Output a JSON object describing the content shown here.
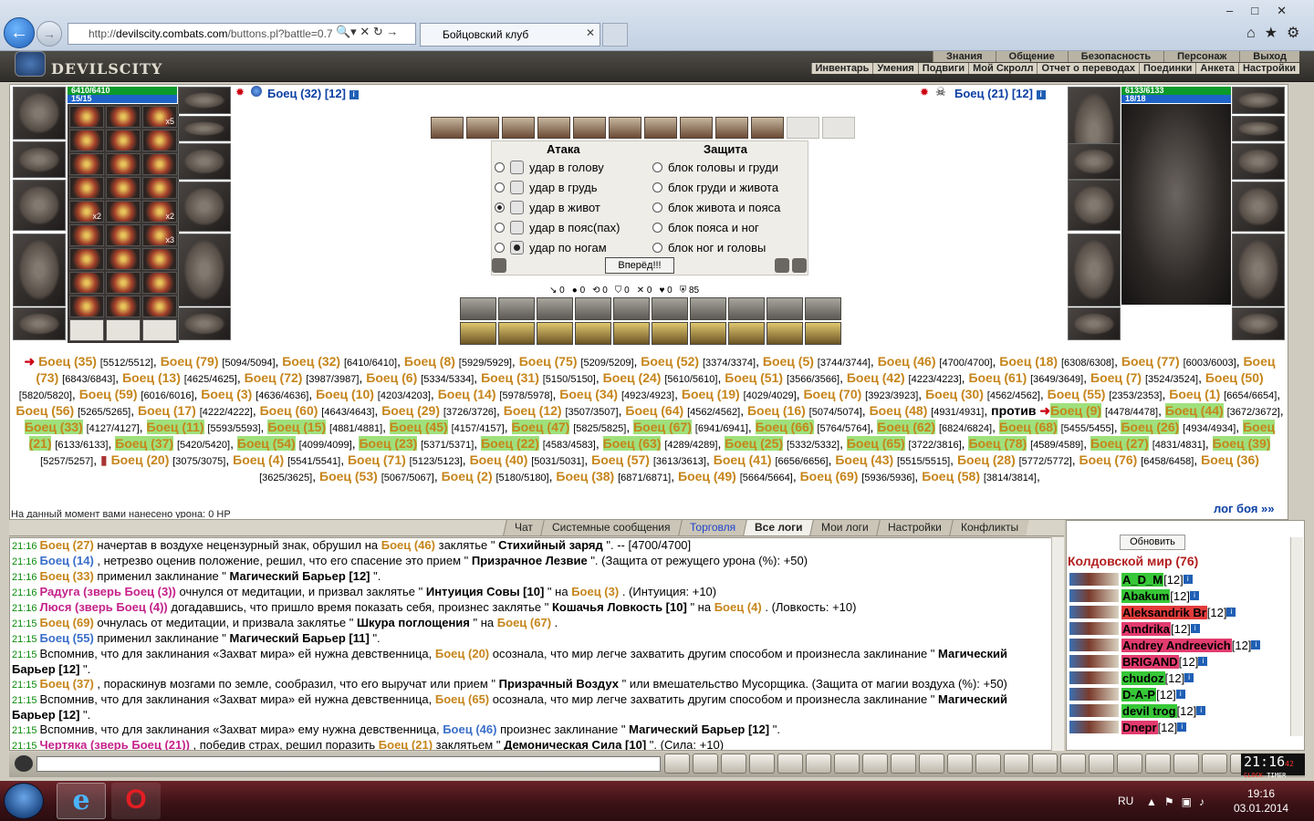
{
  "browser": {
    "url_host": "devilscity.combats.com",
    "url_prefix": "http://",
    "url_path": "/buttons.pl?battle=0.7",
    "tab_title": "Бойцовский клуб"
  },
  "header": {
    "logo": "DEVILSCITY",
    "menu_top": [
      "Знания",
      "Общение",
      "Безопасность",
      "Персонаж",
      "Выход"
    ],
    "menu_sub": [
      "Инвентарь",
      "Умения",
      "Подвиги",
      "Мой Скролл",
      "Отчет о переводах",
      "Поединки",
      "Анкета",
      "Настройки"
    ]
  },
  "player": {
    "name": "Боец (32) [12]",
    "hp": "6410/6410",
    "mana": "15/15",
    "inv_counts": [
      "x5",
      "x2",
      "x2",
      "x3"
    ]
  },
  "enemy": {
    "name": "Боец (21) [12]",
    "hp": "6133/6133",
    "mana": "18/18"
  },
  "attack": {
    "attack_header": "Атака",
    "defense_header": "Защита",
    "attack_options": [
      "удар в голову",
      "удар в грудь",
      "удар в живот",
      "удар в пояс(пах)",
      "удар по ногам"
    ],
    "defense_options": [
      "блок головы и груди",
      "блок груди и живота",
      "блок живота и пояса",
      "блок пояса и ног",
      "блок ног и головы"
    ],
    "go_button": "Вперёд!!!"
  },
  "stats": [
    "0",
    "0",
    "0",
    "0",
    "0",
    "0",
    "85"
  ],
  "fighters": {
    "vs_label": "против",
    "team_a": [
      [
        "Боец (35)",
        "[5512/5512]"
      ],
      [
        "Боец (79)",
        "[5094/5094]"
      ],
      [
        "Боец (32)",
        "[6410/6410]"
      ],
      [
        "Боец (8)",
        "[5929/5929]"
      ],
      [
        "Боец (75)",
        "[5209/5209]"
      ],
      [
        "Боец (52)",
        "[3374/3374]"
      ],
      [
        "Боец (5)",
        "[3744/3744]"
      ],
      [
        "Боец (46)",
        "[4700/4700]"
      ],
      [
        "Боец (18)",
        "[6308/6308]"
      ],
      [
        "Боец (77)",
        "[6003/6003]"
      ],
      [
        "Боец (73)",
        "[6843/6843]"
      ],
      [
        "Боец (13)",
        "[4625/4625]"
      ],
      [
        "Боец (72)",
        "[3987/3987]"
      ],
      [
        "Боец (6)",
        "[5334/5334]"
      ],
      [
        "Боец (31)",
        "[5150/5150]"
      ],
      [
        "Боец (24)",
        "[5610/5610]"
      ],
      [
        "Боец (51)",
        "[3566/3566]"
      ],
      [
        "Боец (42)",
        "[4223/4223]"
      ],
      [
        "Боец (61)",
        "[3649/3649]"
      ],
      [
        "Боец (7)",
        "[3524/3524]"
      ],
      [
        "Боец (50)",
        "[5820/5820]"
      ],
      [
        "Боец (59)",
        "[6016/6016]"
      ],
      [
        "Боец (3)",
        "[4636/4636]"
      ],
      [
        "Боец (10)",
        "[4203/4203]"
      ],
      [
        "Боец (14)",
        "[5978/5978]"
      ],
      [
        "Боец (34)",
        "[4923/4923]"
      ],
      [
        "Боец (19)",
        "[4029/4029]"
      ],
      [
        "Боец (70)",
        "[3923/3923]"
      ],
      [
        "Боец (30)",
        "[4562/4562]"
      ],
      [
        "Боец (55)",
        "[2353/2353]"
      ],
      [
        "Боец (1)",
        "[6654/6654]"
      ],
      [
        "Боец (56)",
        "[5265/5265]"
      ],
      [
        "Боец (17)",
        "[4222/4222]"
      ],
      [
        "Боец (60)",
        "[4643/4643]"
      ],
      [
        "Боец (29)",
        "[3726/3726]"
      ],
      [
        "Боец (12)",
        "[3507/3507]"
      ],
      [
        "Боец (64)",
        "[4562/4562]"
      ],
      [
        "Боец (16)",
        "[5074/5074]"
      ],
      [
        "Боец (48)",
        "[4931/4931]"
      ]
    ],
    "team_b": [
      [
        "Боец (9)",
        "[4478/4478]"
      ],
      [
        "Боец (44)",
        "[3672/3672]"
      ],
      [
        "Боец (33)",
        "[4127/4127]"
      ],
      [
        "Боец (11)",
        "[5593/5593]"
      ],
      [
        "Боец (15)",
        "[4881/4881]"
      ],
      [
        "Боец (45)",
        "[4157/4157]"
      ],
      [
        "Боец (47)",
        "[5825/5825]"
      ],
      [
        "Боец (67)",
        "[6941/6941]"
      ],
      [
        "Боец (66)",
        "[5764/5764]"
      ],
      [
        "Боец (62)",
        "[6824/6824]"
      ],
      [
        "Боец (68)",
        "[5455/5455]"
      ],
      [
        "Боец (26)",
        "[4934/4934]"
      ],
      [
        "Боец (21)",
        "[6133/6133]"
      ],
      [
        "Боец (37)",
        "[5420/5420]"
      ],
      [
        "Боец (54)",
        "[4099/4099]"
      ],
      [
        "Боец (23)",
        "[5371/5371]"
      ],
      [
        "Боец (22)",
        "[4583/4583]"
      ],
      [
        "Боец (63)",
        "[4289/4289]"
      ],
      [
        "Боец (25)",
        "[5332/5332]"
      ],
      [
        "Боец (65)",
        "[3722/3816]"
      ],
      [
        "Боец (78)",
        "[4589/4589]"
      ],
      [
        "Боец (27)",
        "[4831/4831]"
      ],
      [
        "Боец (39)",
        "[5257/5257]"
      ]
    ],
    "team_c": [
      [
        "Боец (20)",
        "[3075/3075]"
      ],
      [
        "Боец (4)",
        "[5541/5541]"
      ],
      [
        "Боец (71)",
        "[5123/5123]"
      ],
      [
        "Боец (40)",
        "[5031/5031]"
      ],
      [
        "Боец (57)",
        "[3613/3613]"
      ],
      [
        "Боец (41)",
        "[6656/6656]"
      ],
      [
        "Боец (43)",
        "[5515/5515]"
      ],
      [
        "Боец (28)",
        "[5772/5772]"
      ],
      [
        "Боец (76)",
        "[6458/6458]"
      ],
      [
        "Боец (36)",
        "[3625/3625]"
      ],
      [
        "Боец (53)",
        "[5067/5067]"
      ],
      [
        "Боец (2)",
        "[5180/5180]"
      ],
      [
        "Боец (38)",
        "[6871/6871]"
      ],
      [
        "Боец (49)",
        "[5664/5664]"
      ],
      [
        "Боец (69)",
        "[5936/5936]"
      ],
      [
        "Боец (58)",
        "[3814/3814]"
      ]
    ],
    "hp_cut_text": "На данный момент вами нанесено урона: 0 HP",
    "battle_log_link": "лог боя »»"
  },
  "tabs": [
    "Чат",
    "Системные сообщения",
    "Торговля",
    "Все логи",
    "Мои логи",
    "Настройки",
    "Конфликты"
  ],
  "chat": [
    {
      "t": "21:16",
      "parts": [
        [
          "n",
          "Боец (27)"
        ],
        [
          "",
          "начертав в воздухе нецензурный знак, обрушил на"
        ],
        [
          "n",
          "Боец (46)"
        ],
        [
          "",
          "заклятье \""
        ],
        [
          "q",
          "Стихийный заряд"
        ],
        [
          "",
          "\". -- [4700/4700]"
        ]
      ]
    },
    {
      "t": "21:16",
      "parts": [
        [
          "nb",
          "Боец (14)"
        ],
        [
          "",
          ", нетрезво оценив положение, решил, что его спасение это прием \""
        ],
        [
          "q",
          "Призрачное Лезвие"
        ],
        [
          "",
          "\". (Защита от режущего урона (%): +50)"
        ]
      ]
    },
    {
      "t": "21:16",
      "parts": [
        [
          "n",
          "Боец (33)"
        ],
        [
          "",
          "применил заклинание \""
        ],
        [
          "q",
          "Магический Барьер [12]"
        ],
        [
          "",
          "\"."
        ]
      ]
    },
    {
      "t": "21:16",
      "parts": [
        [
          "pink",
          "Радуга (зверь Боец (3))"
        ],
        [
          "",
          "очнулся от медитации, и призвал заклятье \""
        ],
        [
          "q",
          "Интуиция Совы [10]"
        ],
        [
          "",
          "\" на"
        ],
        [
          "n",
          "Боец (3)"
        ],
        [
          "",
          ". (Интуиция: +10)"
        ]
      ]
    },
    {
      "t": "21:16",
      "parts": [
        [
          "pink",
          "Люся (зверь Боец (4))"
        ],
        [
          "",
          "догадавшись, что пришло время показать себя, произнес заклятье \""
        ],
        [
          "q",
          "Кошачья Ловкость [10]"
        ],
        [
          "",
          "\" на"
        ],
        [
          "n",
          "Боец (4)"
        ],
        [
          "",
          ". (Ловкость: +10)"
        ]
      ]
    },
    {
      "t": "21:15",
      "parts": [
        [
          "n",
          "Боец (69)"
        ],
        [
          "",
          "очнулась от медитации, и призвала заклятье \""
        ],
        [
          "q",
          "Шкура поглощения"
        ],
        [
          "",
          "\" на"
        ],
        [
          "n",
          "Боец (67)"
        ],
        [
          "",
          "."
        ]
      ]
    },
    {
      "t": "21:15",
      "parts": [
        [
          "nb",
          "Боец (55)"
        ],
        [
          "",
          "применил заклинание \""
        ],
        [
          "q",
          "Магический Барьер [11]"
        ],
        [
          "",
          "\"."
        ]
      ]
    },
    {
      "t": "21:15",
      "parts": [
        [
          "",
          "Вспомнив, что для заклинания «Захват мира» ей нужна девственница,"
        ],
        [
          "n",
          "Боец (20)"
        ],
        [
          "",
          "осознала, что мир легче захватить другим способом и произнесла заклинание \""
        ],
        [
          "q",
          "Магический Барьер [12]"
        ],
        [
          "",
          "\"."
        ]
      ]
    },
    {
      "t": "21:15",
      "parts": [
        [
          "n",
          "Боец (37)"
        ],
        [
          "",
          ", пораскинув мозгами по земле, сообразил, что его выручат или прием \""
        ],
        [
          "q",
          "Призрачный Воздух"
        ],
        [
          "",
          "\" или вмешательство Мусорщика. (Защита от магии воздуха (%): +50)"
        ]
      ]
    },
    {
      "t": "21:15",
      "parts": [
        [
          "",
          "Вспомнив, что для заклинания «Захват мира» ей нужна девственница,"
        ],
        [
          "n",
          "Боец (65)"
        ],
        [
          "",
          "осознала, что мир легче захватить другим способом и произнесла заклинание \""
        ],
        [
          "q",
          "Магический Барьер [12]"
        ],
        [
          "",
          "\"."
        ]
      ]
    },
    {
      "t": "21:15",
      "parts": [
        [
          "",
          "Вспомнив, что для заклинания «Захват мира» ему нужна девственница,"
        ],
        [
          "nb",
          "Боец (46)"
        ],
        [
          "",
          "произнес заклинание \""
        ],
        [
          "q",
          "Магический Барьер [12]"
        ],
        [
          "",
          "\"."
        ]
      ]
    },
    {
      "t": "21:15",
      "parts": [
        [
          "pink",
          "Чертяка (зверь Боец (21))"
        ],
        [
          "",
          ", победив страх, решил поразить"
        ],
        [
          "n",
          "Боец (21)"
        ],
        [
          "",
          "заклятьем \""
        ],
        [
          "q",
          "Демоническая Сила [10]"
        ],
        [
          "",
          "\". (Сила: +10)"
        ]
      ]
    }
  ],
  "online": {
    "refresh_button": "Обновить",
    "title": "Колдовской мир (76)",
    "users": [
      {
        "name": "A_D_M",
        "level": "[12]",
        "bg": "#37c737"
      },
      {
        "name": "Abakum",
        "level": "[12]",
        "bg": "#37c737"
      },
      {
        "name": "Aleksandrik Br",
        "level": "[12]",
        "bg": "#e23b3b"
      },
      {
        "name": "Amdrika",
        "level": "[12]",
        "bg": "#e23b6e"
      },
      {
        "name": "Andrey Andreevich",
        "level": "[12]",
        "bg": "#e23b6e"
      },
      {
        "name": "BRIGAND",
        "level": "[12]",
        "bg": "#e23b6e"
      },
      {
        "name": "chudoz",
        "level": "[12]",
        "bg": "#37c737"
      },
      {
        "name": "D-A-P",
        "level": "[12]",
        "bg": "#37c737"
      },
      {
        "name": "devil trog",
        "level": "[12]",
        "bg": "#37c737"
      },
      {
        "name": "Dnepr",
        "level": "[12]",
        "bg": "#e23b6e"
      }
    ]
  },
  "clock": {
    "time": "21:16",
    "seconds": "42",
    "label1": "CLOCK",
    "label2": "TIMER"
  },
  "taskbar": {
    "lang": "RU",
    "time": "19:16",
    "date": "03.01.2014"
  }
}
